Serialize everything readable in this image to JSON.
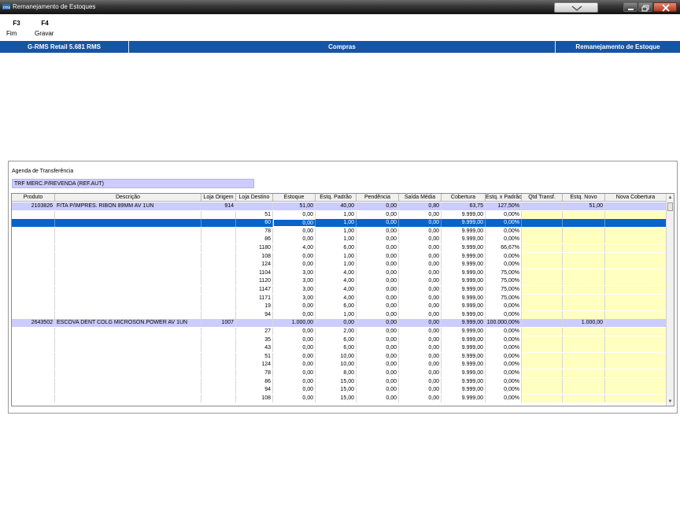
{
  "window": {
    "title": "Remanejamento de Estoques"
  },
  "fkeys": [
    {
      "key": "F3",
      "label": "Fim"
    },
    {
      "key": "F4",
      "label": "Gravar"
    }
  ],
  "header": {
    "left": "G-RMS Retail 5.681 RMS",
    "center": "Compras",
    "right": "Remanejamento de Estoque"
  },
  "agenda": {
    "label": "Agenda de Transferência",
    "value": "TRF MERC.P/REVENDA (REF.AUT)"
  },
  "table": {
    "columns": [
      "Produto",
      "Descrição",
      "Loja Origem",
      "Loja Destino",
      "Estoque",
      "Estq. Padrão",
      "Pendência",
      "Saída Média",
      "Cobertura",
      "Estq. x Padrão",
      "Qtd Transf.",
      "Estq. Novo",
      "Nova Cobertura"
    ],
    "rows": [
      {
        "type": "product",
        "produto": "2103826",
        "descricao": "FITA P/IMPRES. RIBON 89MM     AV   1UN",
        "origem": "914",
        "destino": "",
        "estoque": "51,00",
        "padrao": "40,00",
        "pendencia": "0,00",
        "saida": "0,80",
        "cobertura": "63,75",
        "xpadrao": "127,50%",
        "qtd": "",
        "novo": "51,00",
        "nova_cob": ""
      },
      {
        "type": "store",
        "destino": "51",
        "estoque": "0,00",
        "padrao": "1,00",
        "pendencia": "0,00",
        "saida": "0,00",
        "cobertura": "9.999,00",
        "xpadrao": "0,00%"
      },
      {
        "type": "selected",
        "destino": "60",
        "estoque": "0,00",
        "padrao": "1,00",
        "pendencia": "0,00",
        "saida": "0,00",
        "cobertura": "9.999,00",
        "xpadrao": "0,00%"
      },
      {
        "type": "store",
        "destino": "78",
        "estoque": "0,00",
        "padrao": "1,00",
        "pendencia": "0,00",
        "saida": "0,00",
        "cobertura": "9.999,00",
        "xpadrao": "0,00%"
      },
      {
        "type": "store",
        "destino": "86",
        "estoque": "0,00",
        "padrao": "1,00",
        "pendencia": "0,00",
        "saida": "0,00",
        "cobertura": "9.999,00",
        "xpadrao": "0,00%"
      },
      {
        "type": "store",
        "destino": "1180",
        "estoque": "4,00",
        "padrao": "6,00",
        "pendencia": "0,00",
        "saida": "0,00",
        "cobertura": "9.999,00",
        "xpadrao": "66,67%"
      },
      {
        "type": "store",
        "destino": "108",
        "estoque": "0,00",
        "padrao": "1,00",
        "pendencia": "0,00",
        "saida": "0,00",
        "cobertura": "9.999,00",
        "xpadrao": "0,00%"
      },
      {
        "type": "store",
        "destino": "124",
        "estoque": "0,00",
        "padrao": "1,00",
        "pendencia": "0,00",
        "saida": "0,00",
        "cobertura": "9.999,00",
        "xpadrao": "0,00%"
      },
      {
        "type": "store",
        "destino": "1104",
        "estoque": "3,00",
        "padrao": "4,00",
        "pendencia": "0,00",
        "saida": "0,00",
        "cobertura": "9.999,00",
        "xpadrao": "75,00%"
      },
      {
        "type": "store",
        "destino": "1120",
        "estoque": "3,00",
        "padrao": "4,00",
        "pendencia": "0,00",
        "saida": "0,00",
        "cobertura": "9.999,00",
        "xpadrao": "75,00%"
      },
      {
        "type": "store",
        "destino": "1147",
        "estoque": "3,00",
        "padrao": "4,00",
        "pendencia": "0,00",
        "saida": "0,00",
        "cobertura": "9.999,00",
        "xpadrao": "75,00%"
      },
      {
        "type": "store",
        "destino": "1171",
        "estoque": "3,00",
        "padrao": "4,00",
        "pendencia": "0,00",
        "saida": "0,00",
        "cobertura": "9.999,00",
        "xpadrao": "75,00%"
      },
      {
        "type": "store",
        "destino": "19",
        "estoque": "0,00",
        "padrao": "6,00",
        "pendencia": "0,00",
        "saida": "0,00",
        "cobertura": "9.999,00",
        "xpadrao": "0,00%"
      },
      {
        "type": "store",
        "destino": "94",
        "estoque": "0,00",
        "padrao": "1,00",
        "pendencia": "0,00",
        "saida": "0,00",
        "cobertura": "9.999,00",
        "xpadrao": "0,00%"
      },
      {
        "type": "product",
        "produto": "2643502",
        "descricao": "ESCOVA DENT COLG MICROSON.POWER AV  1UN",
        "origem": "1007",
        "destino": "",
        "estoque": "1.000,00",
        "padrao": "0,00",
        "pendencia": "0,00",
        "saida": "0,00",
        "cobertura": "9.999,00",
        "xpadrao": "100.000,00%",
        "qtd": "",
        "novo": "1.000,00",
        "nova_cob": ""
      },
      {
        "type": "store",
        "destino": "27",
        "estoque": "0,00",
        "padrao": "2,00",
        "pendencia": "0,00",
        "saida": "0,00",
        "cobertura": "9.999,00",
        "xpadrao": "0,00%"
      },
      {
        "type": "store",
        "destino": "35",
        "estoque": "0,00",
        "padrao": "6,00",
        "pendencia": "0,00",
        "saida": "0,00",
        "cobertura": "9.999,00",
        "xpadrao": "0,00%"
      },
      {
        "type": "store",
        "destino": "43",
        "estoque": "0,00",
        "padrao": "6,00",
        "pendencia": "0,00",
        "saida": "0,00",
        "cobertura": "9.999,00",
        "xpadrao": "0,00%"
      },
      {
        "type": "store",
        "destino": "51",
        "estoque": "0,00",
        "padrao": "10,00",
        "pendencia": "0,00",
        "saida": "0,00",
        "cobertura": "9.999,00",
        "xpadrao": "0,00%"
      },
      {
        "type": "store",
        "destino": "124",
        "estoque": "0,00",
        "padrao": "10,00",
        "pendencia": "0,00",
        "saida": "0,00",
        "cobertura": "9.999,00",
        "xpadrao": "0,00%"
      },
      {
        "type": "store",
        "destino": "78",
        "estoque": "0,00",
        "padrao": "8,00",
        "pendencia": "0,00",
        "saida": "0,00",
        "cobertura": "9.999,00",
        "xpadrao": "0,00%"
      },
      {
        "type": "store",
        "destino": "86",
        "estoque": "0,00",
        "padrao": "15,00",
        "pendencia": "0,00",
        "saida": "0,00",
        "cobertura": "9.999,00",
        "xpadrao": "0,00%"
      },
      {
        "type": "store",
        "destino": "94",
        "estoque": "0,00",
        "padrao": "15,00",
        "pendencia": "0,00",
        "saida": "0,00",
        "cobertura": "9.999,00",
        "xpadrao": "0,00%"
      },
      {
        "type": "store",
        "destino": "108",
        "estoque": "0,00",
        "padrao": "15,00",
        "pendencia": "0,00",
        "saida": "0,00",
        "cobertura": "9.999,00",
        "xpadrao": "0,00%"
      }
    ]
  },
  "colors": {
    "header_blue": "#1654a5",
    "product_row": "#ccccff",
    "selected_row": "#0a63c9",
    "editable_cell": "#ffffc0"
  }
}
